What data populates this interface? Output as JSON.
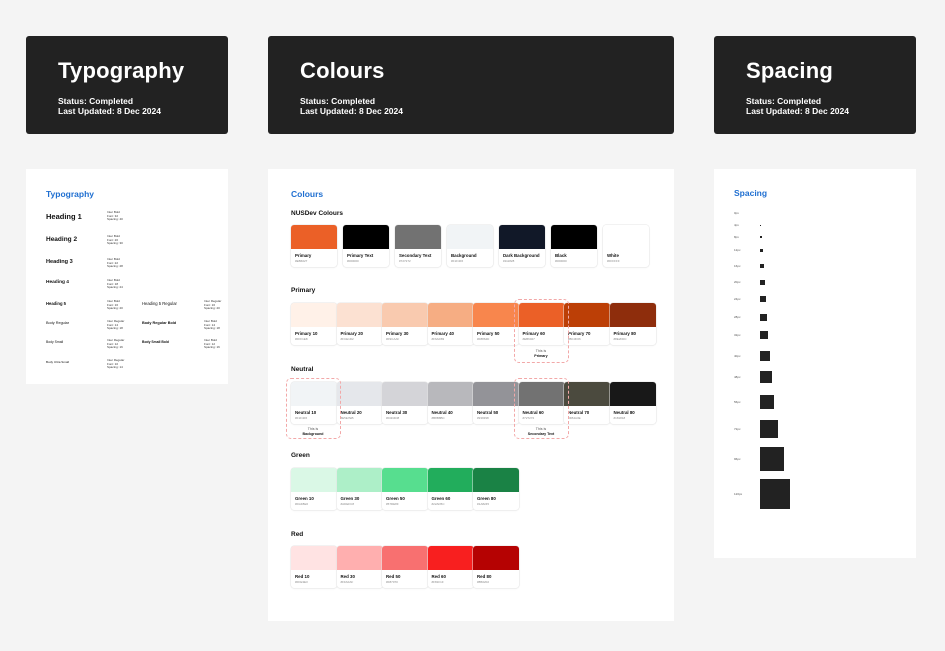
{
  "headers": [
    {
      "title": "Typography",
      "status": "Status: Completed",
      "updated": "Last Updated: 8 Dec 2024"
    },
    {
      "title": "Colours",
      "status": "Status: Completed",
      "updated": "Last Updated: 8 Dec 2024"
    },
    {
      "title": "Spacing",
      "status": "Status: Completed",
      "updated": "Last Updated: 8 Dec 2024"
    }
  ],
  "typography": {
    "title": "Typography",
    "rows": [
      {
        "label": "Heading 1",
        "meta": [
          "Inter Bold",
          "Font: 32",
          "Spacing: 40"
        ]
      },
      {
        "label": "Heading 2",
        "meta": [
          "Inter Bold",
          "Font: 20",
          "Spacing: 30"
        ]
      },
      {
        "label": "Heading 3",
        "meta": [
          "Inter Bold",
          "Font: 22",
          "Spacing: 28"
        ]
      },
      {
        "label": "Heading 4",
        "meta": [
          "Inter Bold",
          "Font: 18",
          "Spacing: 24"
        ]
      },
      {
        "label": "Heading 5",
        "meta": [
          "Inter Bold",
          "Font: 16",
          "Spacing: 20"
        ],
        "alt": "Heading 5 Regular",
        "alt_meta": [
          "Inter Regular",
          "Font: 16",
          "Spacing: 20"
        ]
      },
      {
        "label": "Body Regular",
        "meta": [
          "Inter Regular",
          "Font: 14",
          "Spacing: 18"
        ],
        "alt": "Body Regular Bold",
        "alt_meta": [
          "Inter Bold",
          "Font: 14",
          "Spacing: 18"
        ]
      },
      {
        "label": "Body Small",
        "meta": [
          "Inter Regular",
          "Font: 12",
          "Spacing: 16"
        ],
        "alt": "Body Small Bold",
        "alt_meta": [
          "Inter Bold",
          "Font: 12",
          "Spacing: 16"
        ]
      },
      {
        "label": "Body Ultra Small",
        "meta": [
          "Inter Regular",
          "Font: 10",
          "Spacing: 14"
        ]
      }
    ]
  },
  "colours": {
    "title": "Colours",
    "sections": [
      {
        "name": "NUSDev Colours",
        "swatches": [
          {
            "name": "Primary",
            "hex": "#EB6027",
            "color": "#eb6027"
          },
          {
            "name": "Primary Text",
            "hex": "#000000",
            "color": "#000000"
          },
          {
            "name": "Secondary Text",
            "hex": "#727272",
            "color": "#727272"
          },
          {
            "name": "Background",
            "hex": "#F1F4F6",
            "color": "#f1f4f6"
          },
          {
            "name": "Dark Background",
            "hex": "#111828",
            "color": "#111828"
          },
          {
            "name": "Black",
            "hex": "#000000",
            "color": "#000000"
          },
          {
            "name": "White",
            "hex": "#FFFFFF",
            "color": "#ffffff"
          }
        ]
      },
      {
        "name": "Primary",
        "swatches": [
          {
            "name": "Primary 10",
            "hex": "#FFF1E8",
            "color": "#fff1e8"
          },
          {
            "name": "Primary 20",
            "hex": "#FCE1D2",
            "color": "#fce1d2"
          },
          {
            "name": "Primary 30",
            "hex": "#F9CAAF",
            "color": "#f9caaf"
          },
          {
            "name": "Primary 40",
            "hex": "#F6AD83",
            "color": "#f6ad83"
          },
          {
            "name": "Primary 50",
            "hex": "#F8864D",
            "color": "#f8864d"
          },
          {
            "name": "Primary 60",
            "hex": "#EB6027",
            "color": "#eb6027"
          },
          {
            "name": "Primary 70",
            "hex": "#BC3F06",
            "color": "#bc3f06"
          },
          {
            "name": "Primary 80",
            "hex": "#8E2D0C",
            "color": "#8e2d0c"
          }
        ]
      },
      {
        "name": "Neutral",
        "swatches": [
          {
            "name": "Neutral 10",
            "hex": "#F1F4F6",
            "color": "#f1f4f6"
          },
          {
            "name": "Neutral 20",
            "hex": "#E5E7EB",
            "color": "#e5e7eb"
          },
          {
            "name": "Neutral 30",
            "hex": "#D4D4D8",
            "color": "#d4d4d8"
          },
          {
            "name": "Neutral 40",
            "hex": "#B8B8BC",
            "color": "#b8b8bc"
          },
          {
            "name": "Neutral 50",
            "hex": "#939398",
            "color": "#939398"
          },
          {
            "name": "Neutral 60",
            "hex": "#727272",
            "color": "#727272"
          },
          {
            "name": "Neutral 70",
            "hex": "#4B4A3E",
            "color": "#4b4a3e"
          },
          {
            "name": "Neutral 80",
            "hex": "#181818",
            "color": "#181818"
          }
        ]
      },
      {
        "name": "Green",
        "swatches": [
          {
            "name": "Green 10",
            "hex": "#DAF8E6",
            "color": "#daf8e6"
          },
          {
            "name": "Green 30",
            "hex": "#ADEFC8",
            "color": "#adefc8"
          },
          {
            "name": "Green 50",
            "hex": "#57DE8F",
            "color": "#57de8f"
          },
          {
            "name": "Green 60",
            "hex": "#22AD5C",
            "color": "#22ad5c"
          },
          {
            "name": "Green 80",
            "hex": "#1A8245",
            "color": "#1a8245"
          }
        ]
      },
      {
        "name": "Red",
        "swatches": [
          {
            "name": "Red 10",
            "hex": "#FFE3E3",
            "color": "#ffe3e3"
          },
          {
            "name": "Red 30",
            "hex": "#FFAFAF",
            "color": "#ffafaf"
          },
          {
            "name": "Red 50",
            "hex": "#F87070",
            "color": "#f87070"
          },
          {
            "name": "Red 60",
            "hex": "#F81F1F",
            "color": "#f81f1f"
          },
          {
            "name": "Red 80",
            "hex": "#B50202",
            "color": "#b50202"
          }
        ]
      }
    ],
    "notes": {
      "primary": [
        "This is",
        "Primary"
      ],
      "background": [
        "This is",
        "Background"
      ],
      "secondary": [
        "This is",
        "Secondary Text"
      ]
    }
  },
  "spacing": {
    "title": "Spacing",
    "items": [
      {
        "label": "0px",
        "size": 0
      },
      {
        "label": "4px",
        "size": 4
      },
      {
        "label": "8px",
        "size": 8
      },
      {
        "label": "12px",
        "size": 12
      },
      {
        "label": "16px",
        "size": 16
      },
      {
        "label": "20px",
        "size": 20
      },
      {
        "label": "24px",
        "size": 24
      },
      {
        "label": "28px",
        "size": 28
      },
      {
        "label": "32px",
        "size": 32
      },
      {
        "label": "40px",
        "size": 40
      },
      {
        "label": "48px",
        "size": 48
      },
      {
        "label": "56px",
        "size": 56
      },
      {
        "label": "72px",
        "size": 72
      },
      {
        "label": "96px",
        "size": 96
      },
      {
        "label": "120px",
        "size": 120
      }
    ]
  }
}
